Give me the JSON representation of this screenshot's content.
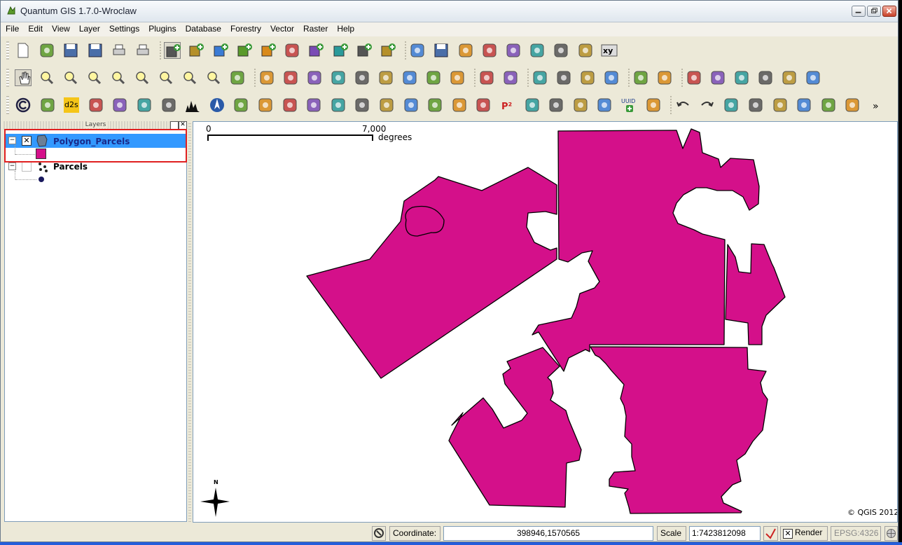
{
  "window": {
    "title": "Quantum GIS 1.7.0-Wroclaw"
  },
  "menu": [
    "File",
    "Edit",
    "View",
    "Layer",
    "Settings",
    "Plugins",
    "Database",
    "Forestry",
    "Vector",
    "Raster",
    "Help"
  ],
  "layers_panel": {
    "title": "Layers",
    "layers": [
      {
        "name": "Polygon_Parcels",
        "visible": true,
        "selected": true,
        "symbol_color": "#d4108a"
      },
      {
        "name": "Parcels",
        "visible": false,
        "selected": false,
        "symbol_color": "#1a1a5e"
      }
    ]
  },
  "map": {
    "scalebar": {
      "start": "0",
      "end": "7,000",
      "unit": "degrees"
    },
    "north_arrow": "N",
    "copyright": "© QGIS 2012",
    "fill_color": "#d4108a"
  },
  "toolbar3": {
    "uuid_label": "UUID",
    "p2_label": "P²",
    "d2s_label": "d2s"
  },
  "status": {
    "coordinate_label": "Coordinate:",
    "coordinate_value": "398946,1570565",
    "scale_label": "Scale",
    "scale_value": "1:7423812098",
    "render_label": "Render",
    "crs": "EPSG:4326"
  },
  "icons": {
    "tb1": [
      "new-project-icon",
      "open-project-icon",
      "save-project-icon",
      "save-as-icon",
      "print-composer-icon",
      "print-icon",
      "add-vector-layer-icon",
      "add-raster-layer-icon",
      "add-postgis-layer-icon",
      "add-spatialite-layer-icon",
      "add-wms-layer-icon",
      "new-shapefile-icon",
      "remove-layer-icon",
      "add-wfs-layer-icon",
      "add-gps-layer-icon",
      "add-oracle-layer-icon",
      "toggle-editing-icon",
      "save-edits-icon",
      "move-feature-icon",
      "node-tool-icon",
      "delete-selected-icon",
      "cut-features-icon",
      "copy-features-icon",
      "paste-features-icon",
      "xy-tool-icon"
    ],
    "tb2": [
      "pan-icon",
      "zoom-in-icon",
      "zoom-out-icon",
      "zoom-full-icon",
      "zoom-layer-icon",
      "zoom-selection-icon",
      "zoom-native-icon",
      "zoom-last-icon",
      "zoom-next-icon",
      "refresh-icon",
      "identify-icon",
      "select-icon",
      "deselect-icon",
      "attribute-table-icon",
      "measure-icon",
      "map-tips-icon",
      "new-bookmark-icon",
      "show-bookmarks-icon",
      "text-annotation-icon",
      "simplify-icon",
      "add-ring-icon",
      "label-icon",
      "move-label-icon",
      "rotate-label-icon",
      "change-label-icon",
      "python-icon",
      "whats-this-icon",
      "fTools-1-icon",
      "fTools-2-icon",
      "fTools-3-icon",
      "fTools-4-icon",
      "fTools-5-icon",
      "fTools-6-icon"
    ],
    "tb3": [
      "copyright-icon",
      "spatial-query-icon",
      "d2s-icon",
      "gps-icon",
      "interpolation-icon",
      "raster-terrain-icon",
      "georeferencer-icon",
      "histogram-icon",
      "north-arrow-icon",
      "db-manager-icon",
      "heatmap-icon",
      "grass-icon",
      "zonal-stats-icon",
      "plugin-green-icon",
      "scalebar-icon",
      "road-graph-icon",
      "mapserver-icon",
      "db-export-icon",
      "sextante-icon",
      "osm-icon",
      "p2-icon",
      "gps-tools-icon",
      "plugin-pencil-icon",
      "plugin-rotate-icon",
      "edit-icon",
      "uuid-icon",
      "picture-icon",
      "undo-icon",
      "redo-icon",
      "polygon-tool-icon",
      "ring-tool-icon",
      "rotate-tool-icon",
      "split-tool-icon",
      "merge-tool-icon",
      "reshape-tool-icon",
      "more-icon"
    ]
  }
}
